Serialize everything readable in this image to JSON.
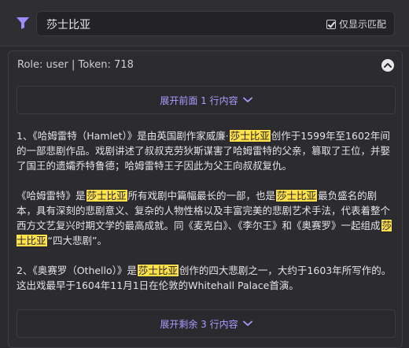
{
  "search": {
    "value": "莎士比亚",
    "only_match_label": "仅显示匹配",
    "only_match_checked": true
  },
  "message": {
    "meta": "Role: user | Token: 718",
    "expand_top_label": "展开前面 1 行内容",
    "expand_bottom_label": "展开剩余 3 行内容",
    "highlight_term": "莎士比亚",
    "paragraphs": [
      [
        {
          "t": "1、《哈姆雷特（Hamlet）》是由英国剧作家威廉·"
        },
        {
          "t": "莎士比亚",
          "hl": true
        },
        {
          "t": "创作于1599年至1602年间的一部悲剧作品。戏剧讲述了叔叔克劳狄斯谋害了哈姆雷特的父亲，篡取了王位，并娶了国王的遗孀乔特鲁德；哈姆雷特王子因此为父王向叔叔复仇。"
        }
      ],
      [
        {
          "t": "《哈姆雷特》是"
        },
        {
          "t": "莎士比亚",
          "hl": true
        },
        {
          "t": "所有戏剧中篇幅最长的一部，也是"
        },
        {
          "t": "莎士比亚",
          "hl": true
        },
        {
          "t": "最负盛名的剧本，具有深刻的悲剧意义、复杂的人物性格以及丰富完美的悲剧艺术手法，代表着整个西方文艺复兴时期文学的最高成就。同《麦克白》、《李尔王》和《奥赛罗》一起组成"
        },
        {
          "t": "莎士比亚",
          "hl": true
        },
        {
          "t": "“四大悲剧”。"
        }
      ],
      [
        {
          "t": "2、《奥赛罗（Othello）》是"
        },
        {
          "t": "莎士比亚",
          "hl": true
        },
        {
          "t": "创作的四大悲剧之一，大约于1603年所写作的。这出戏最早于1604年11月1日在伦敦的Whitehall Palace首演。"
        }
      ]
    ]
  },
  "colors": {
    "accent": "#a99cff",
    "highlight": "#ffe14a",
    "background": "#2b2b2f"
  },
  "icons": {
    "filter": "filter-icon",
    "collapse": "chevron-up-icon",
    "expand": "chevron-down-icon"
  }
}
